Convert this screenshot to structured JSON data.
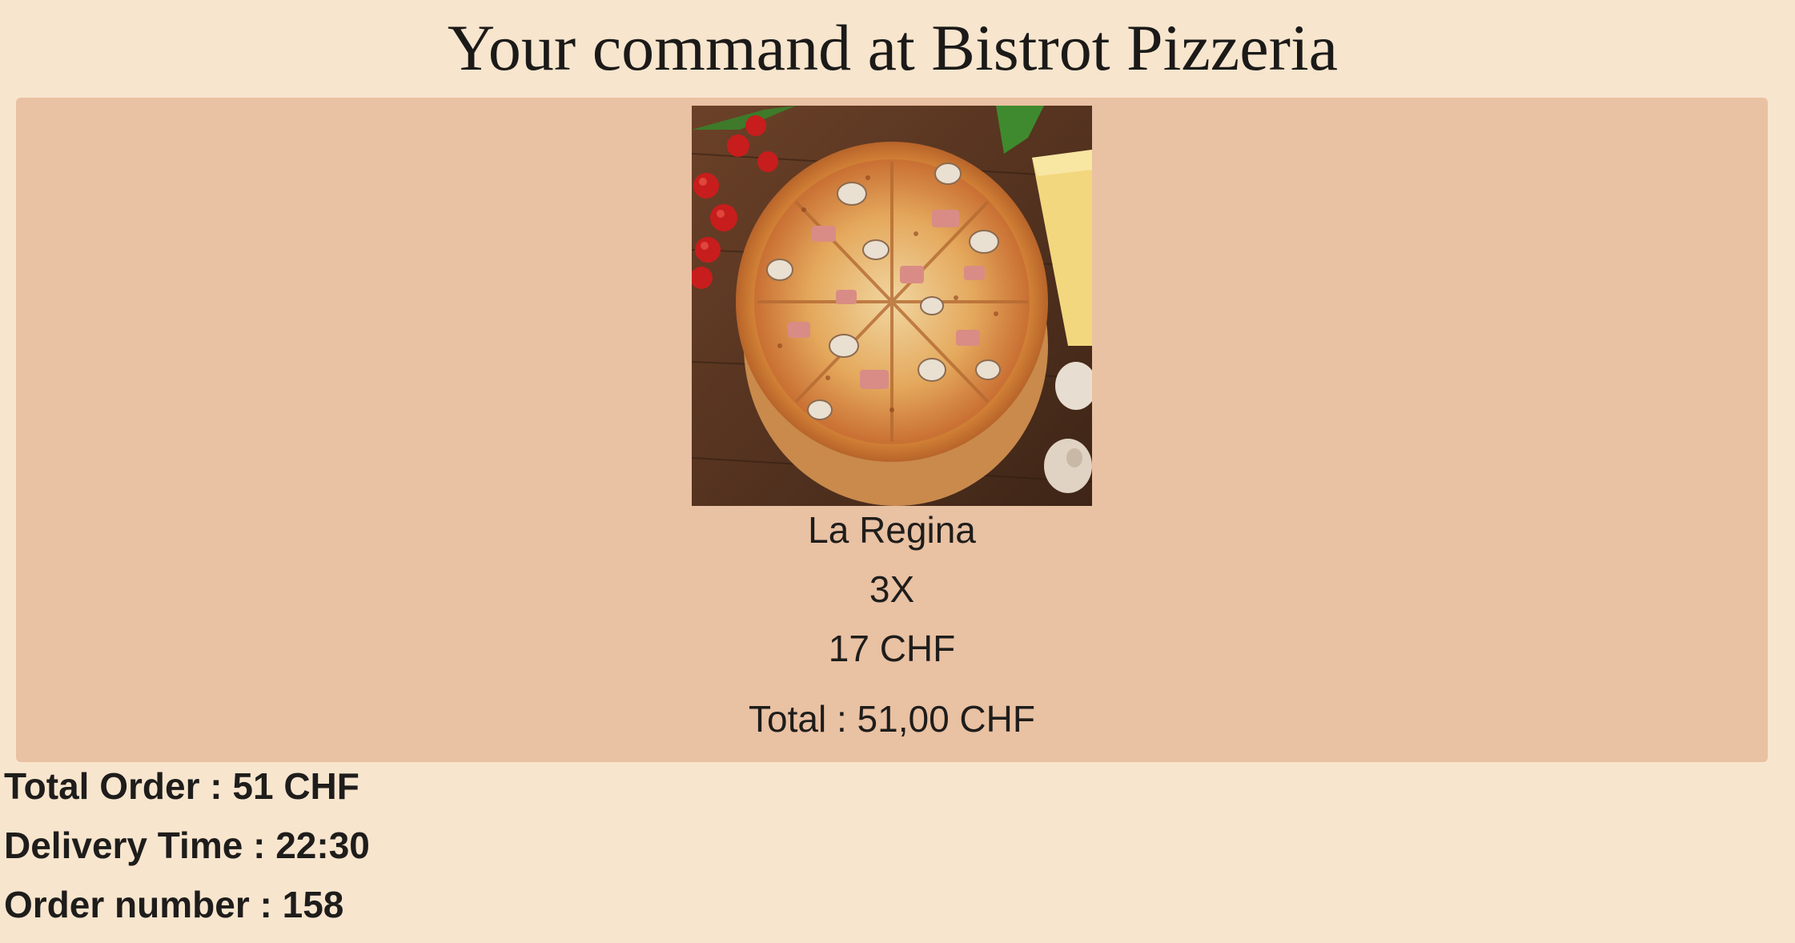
{
  "page": {
    "title": "Your command at Bistrot Pizzeria"
  },
  "order_item": {
    "image_subject": "pizza-photo",
    "name": "La Regina",
    "quantity": "3X",
    "unit_price": "17 CHF",
    "line_total": "Total : 51,00 CHF"
  },
  "summary": {
    "total_order": "Total Order : 51 CHF",
    "delivery_time": "Delivery Time : 22:30",
    "order_number": "Order number : 158"
  },
  "colors": {
    "page_background": "#f8e5ce",
    "card_background": "#e9c1a3",
    "text": "#1e1d1b"
  }
}
